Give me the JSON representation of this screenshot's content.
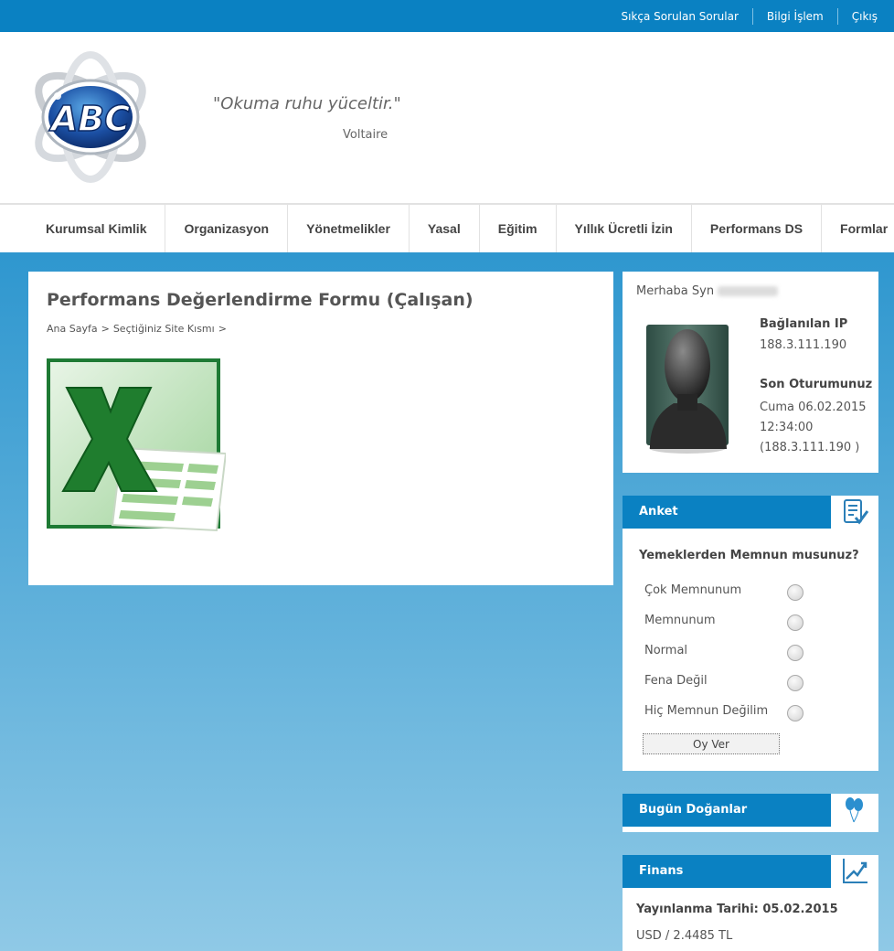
{
  "topbar": {
    "links": [
      "Sıkça Sorulan Sorular",
      "Bilgi İşlem",
      "Çıkış"
    ]
  },
  "header": {
    "logo_text": "ABC",
    "quote": "\"Okuma ruhu yüceltir.\"",
    "author": "Voltaire"
  },
  "nav": {
    "items": [
      "Kurumsal Kimlik",
      "Organizasyon",
      "Yönetmelikler",
      "Yasal",
      "Eğitim",
      "Yıllık Ücretli İzin",
      "Performans DS",
      "Formlar"
    ]
  },
  "main": {
    "title": "Performans Değerlendirme Formu (Çalışan)",
    "breadcrumb": [
      "Ana Sayfa",
      "Seçtiğiniz Site Kısmı"
    ],
    "breadcrumb_sep": ">",
    "file_icon": "excel-icon"
  },
  "user": {
    "greeting": "Merhaba Syn",
    "ip_label": "Bağlanılan IP",
    "ip": "188.3.111.190",
    "last_label": "Son Oturumunuz",
    "last_date": "Cuma 06.02.2015",
    "last_time": "12:34:00",
    "last_ip": "(188.3.111.190 )"
  },
  "anket": {
    "title": "Anket",
    "question": "Yemeklerden Memnun musunuz?",
    "options": [
      "Çok Memnunum",
      "Memnunum",
      "Normal",
      "Fena Değil",
      "Hiç Memnun Değilim"
    ],
    "button": "Oy Ver"
  },
  "dogan": {
    "title": "Bugün Doğanlar"
  },
  "finans": {
    "title": "Finans",
    "date_label": "Yayınlanma Tarihi: 05.02.2015",
    "usd": "USD / 2.4485 TL"
  },
  "colors": {
    "brand_blue": "#0a81c2",
    "excel_green": "#1e7a34"
  }
}
